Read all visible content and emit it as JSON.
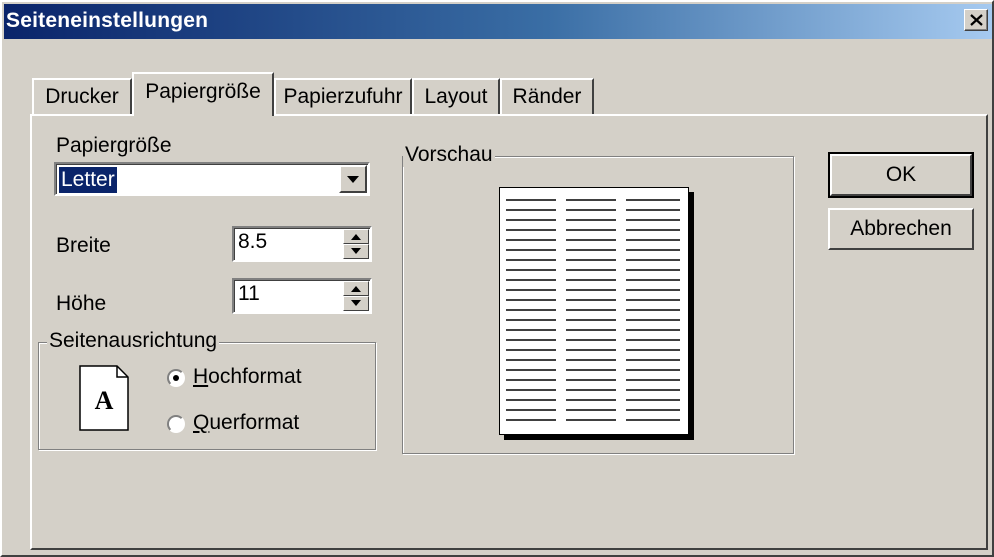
{
  "window": {
    "title": "Seiteneinstellungen"
  },
  "tabs": [
    {
      "label": "Drucker"
    },
    {
      "label": "Papiergröße"
    },
    {
      "label": "Papierzufuhr"
    },
    {
      "label": "Layout"
    },
    {
      "label": "Ränder"
    }
  ],
  "paper": {
    "size_label": "Papiergröße",
    "size_value": "Letter",
    "width_label": "Breite",
    "width_value": "8.5",
    "height_label": "Höhe",
    "height_value": "11"
  },
  "orientation": {
    "group_label": "Seitenausrichtung",
    "portrait_label": "Hochformat",
    "portrait_mnemonic": "H",
    "portrait_rest": "ochformat",
    "landscape_label": "Querformat",
    "landscape_mnemonic": "Q",
    "landscape_rest": "uerformat",
    "selected": "Hochformat",
    "page_icon_letter": "A"
  },
  "preview": {
    "label": "Vorschau"
  },
  "buttons": {
    "ok": "OK",
    "cancel": "Abbrechen"
  },
  "colors": {
    "title_start": "#0a246a",
    "title_end": "#a6caf0",
    "face": "#d4d0c8",
    "selection": "#0a246a"
  }
}
